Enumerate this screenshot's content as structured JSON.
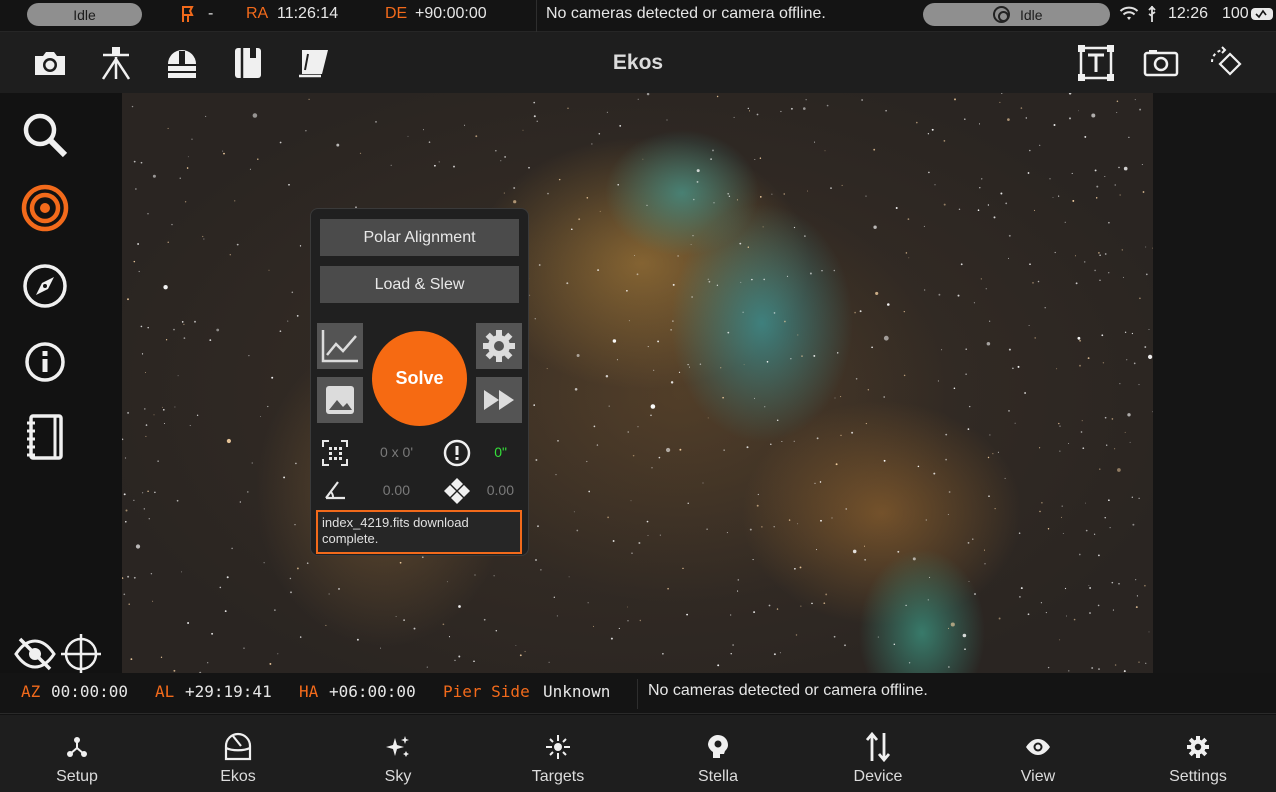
{
  "status_bar": {
    "mount_state": "Idle",
    "park_glyph": "-",
    "ra_label": "RA",
    "ra_value": "11:26:14",
    "de_label": "DE",
    "de_value": "+90:00:00",
    "camera_message": "No cameras detected or camera offline.",
    "capture_state": "Idle",
    "clock": "12:26",
    "battery": "100"
  },
  "toolbar": {
    "title": "Ekos",
    "left_icons": [
      "camera-icon",
      "tripod-mount-icon",
      "dome-icon",
      "notebook-icon",
      "flat-panel-icon"
    ],
    "right_icons": [
      "text-overlay-icon",
      "capture-frame-icon",
      "rotate-icon"
    ]
  },
  "left_rail": {
    "icons": [
      "search-icon",
      "target-rings-icon",
      "compass-icon",
      "info-icon",
      "logbook-icon"
    ],
    "active": "target-rings-icon"
  },
  "align_panel": {
    "polar_alignment_label": "Polar Alignment",
    "load_slew_label": "Load & Slew",
    "solve_label": "Solve",
    "field_of_view": "0 x 0'",
    "error": "0\"",
    "rotation": "0.00",
    "pixel_scale": "0.00",
    "status_message": "index_4219.fits download complete."
  },
  "info_bar": {
    "az_label": "AZ",
    "az_value": "00:00:00",
    "al_label": "AL",
    "al_value": "+29:19:41",
    "ha_label": "HA",
    "ha_value": "+06:00:00",
    "pier_label": "Pier Side",
    "pier_value": "Unknown",
    "camera_message": "No cameras detected or camera offline."
  },
  "bottom_nav": [
    {
      "label": "Setup",
      "icon": "setup-icon"
    },
    {
      "label": "Ekos",
      "icon": "ekos-icon"
    },
    {
      "label": "Sky",
      "icon": "sky-icon"
    },
    {
      "label": "Targets",
      "icon": "targets-icon"
    },
    {
      "label": "Stella",
      "icon": "stella-icon"
    },
    {
      "label": "Device",
      "icon": "device-icon"
    },
    {
      "label": "View",
      "icon": "view-icon"
    },
    {
      "label": "Settings",
      "icon": "settings-icon"
    }
  ],
  "colors": {
    "accent": "#f26a1b",
    "solve_button": "#f66a12",
    "error_ok": "#35e03a"
  }
}
